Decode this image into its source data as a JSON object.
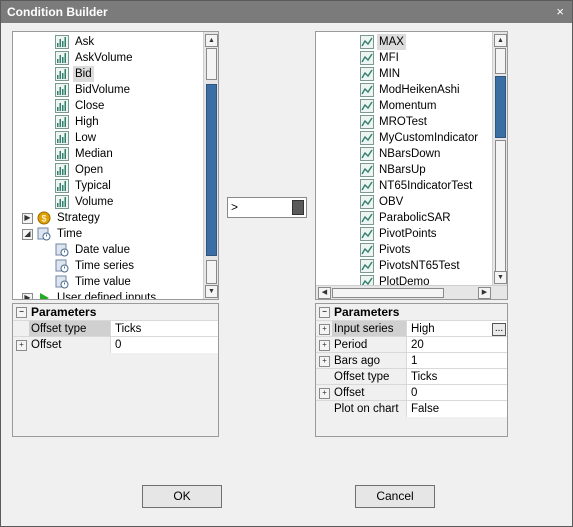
{
  "window": {
    "title": "Condition Builder",
    "close_glyph": "×"
  },
  "left_tree": {
    "items": [
      {
        "label": "Ask",
        "icon": "indicator-chart-icon"
      },
      {
        "label": "AskVolume",
        "icon": "indicator-chart-icon"
      },
      {
        "label": "Bid",
        "icon": "indicator-chart-icon",
        "selected": true
      },
      {
        "label": "BidVolume",
        "icon": "indicator-chart-icon"
      },
      {
        "label": "Close",
        "icon": "indicator-chart-icon"
      },
      {
        "label": "High",
        "icon": "indicator-chart-icon"
      },
      {
        "label": "Low",
        "icon": "indicator-chart-icon"
      },
      {
        "label": "Median",
        "icon": "indicator-chart-icon"
      },
      {
        "label": "Open",
        "icon": "indicator-chart-icon"
      },
      {
        "label": "Typical",
        "icon": "indicator-chart-icon"
      },
      {
        "label": "Volume",
        "icon": "indicator-chart-icon"
      },
      {
        "label": "Strategy",
        "icon": "strategy-coin-icon",
        "expander": "▶"
      },
      {
        "label": "Time",
        "icon": "time-icon",
        "expander": "◢"
      },
      {
        "label": "Date value",
        "icon": "time-icon"
      },
      {
        "label": "Time series",
        "icon": "time-icon"
      },
      {
        "label": "Time value",
        "icon": "time-icon"
      },
      {
        "label": "User defined inputs",
        "icon": "play-arrow-icon",
        "expander": "▶"
      }
    ]
  },
  "operator": {
    "value": ">"
  },
  "right_tree": {
    "items": [
      {
        "label": "MAX",
        "selected": true
      },
      {
        "label": "MFI"
      },
      {
        "label": "MIN"
      },
      {
        "label": "ModHeikenAshi"
      },
      {
        "label": "Momentum"
      },
      {
        "label": "MROTest"
      },
      {
        "label": "MyCustomIndicator"
      },
      {
        "label": "NBarsDown"
      },
      {
        "label": "NBarsUp"
      },
      {
        "label": "NT65IndicatorTest"
      },
      {
        "label": "OBV"
      },
      {
        "label": "ParabolicSAR"
      },
      {
        "label": "PivotPoints"
      },
      {
        "label": "Pivots"
      },
      {
        "label": "PivotsNT65Test"
      },
      {
        "label": "PlotDemo"
      }
    ]
  },
  "left_params": {
    "header": "Parameters",
    "rows": [
      {
        "name": "Offset type",
        "value": "Ticks",
        "expand": false,
        "selected": true
      },
      {
        "name": "Offset",
        "value": "0",
        "expand": true
      }
    ]
  },
  "right_params": {
    "header": "Parameters",
    "rows": [
      {
        "name": "Input series",
        "value": "High",
        "expand": true,
        "selected": true,
        "has_button": true
      },
      {
        "name": "Period",
        "value": "20",
        "expand": true
      },
      {
        "name": "Bars ago",
        "value": "1",
        "expand": true
      },
      {
        "name": "Offset type",
        "value": "Ticks",
        "expand": false
      },
      {
        "name": "Offset",
        "value": "0",
        "expand": true
      },
      {
        "name": "Plot on chart",
        "value": "False",
        "expand": false
      }
    ],
    "ellipsis": "..."
  },
  "buttons": {
    "ok": "OK",
    "cancel": "Cancel"
  },
  "glyphs": {
    "collapse": "−",
    "expand": "+",
    "up": "▲",
    "down": "▼",
    "left": "◀",
    "right": "▶"
  },
  "colors": {
    "chart_icon": "#2f7f6f",
    "coin_icon": "#e0a000",
    "play_icon": "#22aa22"
  }
}
